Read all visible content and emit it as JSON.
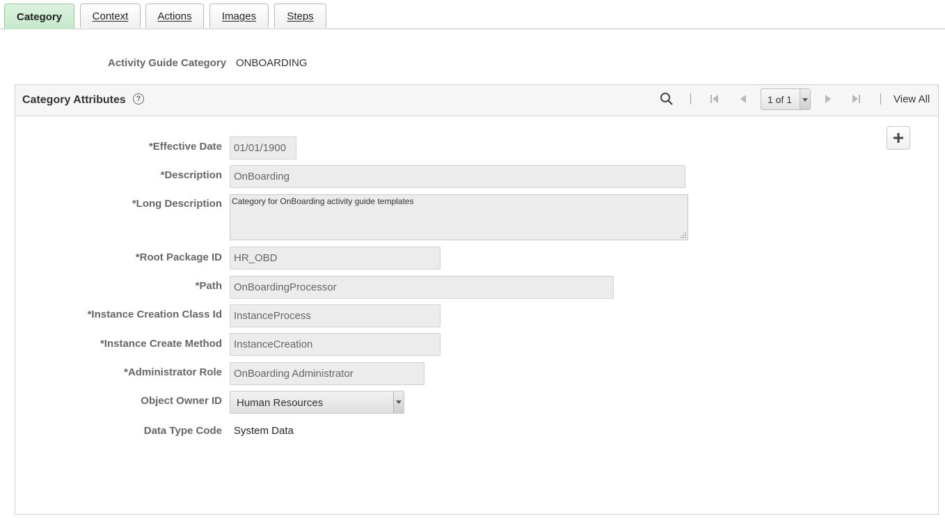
{
  "tabs": [
    {
      "label": "Category"
    },
    {
      "label": "Context"
    },
    {
      "label": "Actions"
    },
    {
      "label": "Images"
    },
    {
      "label": "Steps"
    }
  ],
  "header": {
    "label": "Activity Guide Category",
    "value": "ONBOARDING"
  },
  "panel": {
    "title": "Category Attributes",
    "pager": "1 of 1",
    "view_all": "View All"
  },
  "fields": {
    "effective_date": {
      "label": "*Effective Date",
      "value": "01/01/1900"
    },
    "description": {
      "label": "*Description",
      "value": "OnBoarding"
    },
    "long_description": {
      "label": "*Long Description",
      "value": "Category for OnBoarding activity guide templates"
    },
    "root_package_id": {
      "label": "*Root Package ID",
      "value": "HR_OBD"
    },
    "path": {
      "label": "*Path",
      "value": "OnBoardingProcessor"
    },
    "instance_creation_class_id": {
      "label": "*Instance Creation Class Id",
      "value": "InstanceProcess"
    },
    "instance_create_method": {
      "label": "*Instance Create Method",
      "value": "InstanceCreation"
    },
    "administrator_role": {
      "label": "*Administrator Role",
      "value": "OnBoarding Administrator"
    },
    "object_owner_id": {
      "label": "Object Owner ID",
      "value": "Human Resources"
    },
    "data_type_code": {
      "label": "Data Type Code",
      "value": "System Data"
    }
  },
  "icons": [
    "help-icon",
    "search-icon",
    "first-icon",
    "previous-icon",
    "next-icon",
    "last-icon",
    "add-icon",
    "chevron-down-icon"
  ],
  "colors": {
    "active_tab": "#c6e8cc",
    "input_bg": "#ececec",
    "label": "#666666"
  }
}
